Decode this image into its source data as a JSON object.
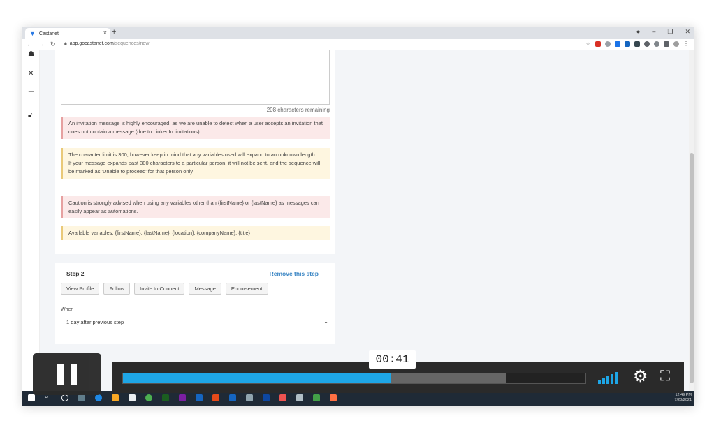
{
  "browser": {
    "tab_title": "Castanet",
    "url_host": "app.gocastanet.com",
    "url_path": "/sequences/new"
  },
  "content": {
    "chars_remaining": "208 characters remaining",
    "alerts": [
      "An invitation message is highly encouraged, as we are unable to detect when a user accepts an invitation that does not contain a message (due to LinkedIn limitations).",
      "The character limit is 300, however keep in mind that any variables used will expand to an unknown length.",
      "If your message expands past 300 characters to a particular person, it will not be sent, and the sequence will be marked as 'Unable to proceed' for that person only",
      "Caution is strongly advised when using any variables other than {firstName} or {lastName} as messages can easily appear as automations.",
      "Available variables: {firstName}, {lastName}, {location}, {companyName}, {title}"
    ]
  },
  "step2": {
    "title": "Step 2",
    "remove_label": "Remove this step",
    "buttons": [
      "View Profile",
      "Follow",
      "Invite to Connect",
      "Message",
      "Endorsement"
    ],
    "when_label": "When",
    "when_value": "1 day after previous step"
  },
  "video": {
    "time": "00:41",
    "progress": 0.58,
    "buffered": 0.83
  },
  "taskbar": {
    "time": "12:49 PM",
    "date": "7/28/2021"
  },
  "icons": [
    "castanet-logo-icon",
    "close-icon",
    "tab-close-icon",
    "new-tab-icon",
    "back-icon",
    "forward-icon",
    "reload-icon",
    "lock-icon",
    "star-icon",
    "pause-icon",
    "volume-icon",
    "settings-gear-icon",
    "fullscreen-icon",
    "sidebar-user-icon",
    "sidebar-x-icon",
    "sidebar-sliders-icon",
    "sidebar-lock-icon",
    "chevron-down-icon"
  ]
}
